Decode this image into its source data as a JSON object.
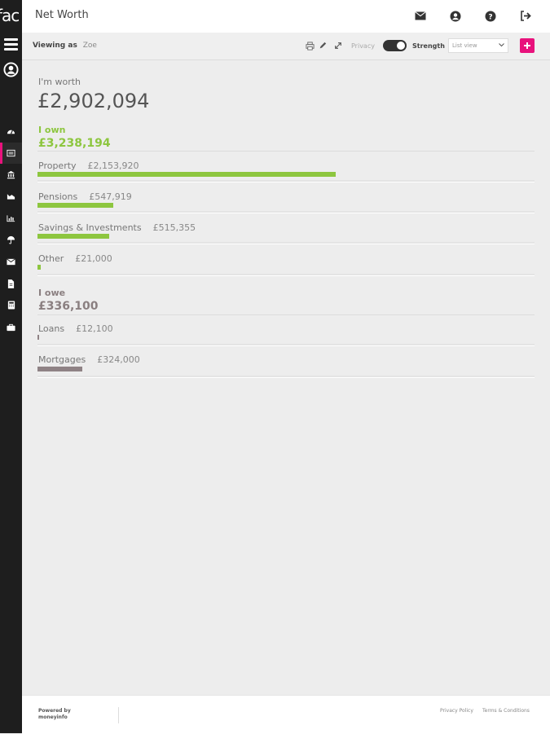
{
  "logo": {
    "text": "fac"
  },
  "header": {
    "title": "Net Worth",
    "icons": [
      "envelope-icon",
      "user-icon",
      "help-icon",
      "logout-icon"
    ]
  },
  "sidebar": {
    "items": [
      "dashboard-icon",
      "balance-sheet-icon",
      "bank-icon",
      "area-chart-icon",
      "bar-chart-icon",
      "umbrella-icon",
      "mail-icon",
      "document-icon",
      "calculator-icon",
      "briefcase-icon"
    ],
    "active_index": 1
  },
  "toolbar": {
    "viewing_label": "Viewing as",
    "viewing_name": "Zoe",
    "privacy_label": "Privacy",
    "strength_label": "Strength",
    "view_select": "List view",
    "privacy_on": true
  },
  "summary": {
    "label": "I'm worth",
    "value": "£2,902,094"
  },
  "own": {
    "title": "I own",
    "total": "£3,238,194",
    "items": [
      {
        "label": "Property",
        "amount": "£2,153,920",
        "fraction": 0.6
      },
      {
        "label": "Pensions",
        "amount": "£547,919",
        "fraction": 0.153
      },
      {
        "label": "Savings & Investments",
        "amount": "£515,355",
        "fraction": 0.144
      },
      {
        "label": "Other",
        "amount": "£21,000",
        "fraction": 0.006
      }
    ]
  },
  "owe": {
    "title": "I owe",
    "total": "£336,100",
    "items": [
      {
        "label": "Loans",
        "amount": "£12,100",
        "fraction": 0.003
      },
      {
        "label": "Mortgages",
        "amount": "£324,000",
        "fraction": 0.09
      }
    ]
  },
  "colors": {
    "own": "#8dc63f",
    "owe": "#8f8285",
    "accent": "#e8127c",
    "sidebar": "#1e1e1e"
  },
  "footer": {
    "powered_line1": "Powered by",
    "powered_line2": "moneyinfo",
    "privacy_link": "Privacy Policy",
    "terms_link": "Terms & Conditions"
  }
}
